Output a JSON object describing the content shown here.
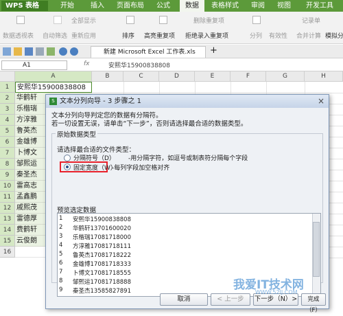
{
  "menubar": {
    "app_label": "WPS 表格",
    "items": [
      "开始",
      "插入",
      "页面布局",
      "公式",
      "数据",
      "表格样式",
      "审阅",
      "视图",
      "开发工具"
    ],
    "active_index": 4
  },
  "ribbon": {
    "buttons": [
      "数据透视表",
      "自动筛选",
      "全部显示",
      "重新应用",
      "排序",
      "高亮重复项",
      "删除重复项",
      "拒绝录入重复项",
      "分列",
      "有效性",
      "记录单",
      "合并计算",
      "模拟分"
    ]
  },
  "toolbar": {
    "document_tab": "新建 Microsoft Excel 工作表.xls",
    "new_tab": "+"
  },
  "formula": {
    "cell_ref": "A1",
    "fx_label": "fx",
    "content": "安熙华15900838808"
  },
  "sheet": {
    "columns": [
      "A",
      "B",
      "C",
      "D",
      "E",
      "F",
      "G",
      "H"
    ],
    "rows": [
      "1",
      "2",
      "3",
      "4",
      "5",
      "6",
      "7",
      "8",
      "9",
      "10",
      "11",
      "12",
      "13",
      "14",
      "15",
      "16"
    ],
    "cells": [
      "安熙华15900838808",
      "华鹤轩",
      "乐楷瑞",
      "方淳雅",
      "鲁英杰",
      "金雄博",
      "卜博文",
      "邹熙运",
      "秦圣杰",
      "雷高志",
      "孟鑫鹏",
      "戚熙茂",
      "雷德厚",
      "费鹤轩",
      "云俊朗",
      ""
    ]
  },
  "dialog": {
    "title": "文本分列向导 - 3 步骤之 1",
    "close": "×",
    "intro1": "文本分列向导判定您的数据有分隔符。",
    "intro2": "若一切设置无误，请单击“下一步”，否则请选择最合适的数据类型。",
    "group_title": "原始数据类型",
    "choose_label": "请选择最合适的文件类型：",
    "radio1_label": "分隔符号（D）",
    "radio1_desc": "-用分隔字符，如逗号或制表符分隔每个字段",
    "radio2_label": "固定宽度（W）",
    "radio2_desc": "-每列字段加空格对齐",
    "selected_option": "固定宽度（W）",
    "preview_label": "预览选定数据",
    "preview_rows": [
      {
        "n": "1",
        "t": "安熙华15900838808"
      },
      {
        "n": "2",
        "t": "华鹤轩13701600020"
      },
      {
        "n": "3",
        "t": "乐楷瑞17081718000"
      },
      {
        "n": "4",
        "t": "方淳雅17081718111"
      },
      {
        "n": "5",
        "t": "鲁英杰17081718222"
      },
      {
        "n": "6",
        "t": "金雄博17081718333"
      },
      {
        "n": "7",
        "t": "卜博文17081718555"
      },
      {
        "n": "8",
        "t": "邹熙运17081718888"
      },
      {
        "n": "9",
        "t": "秦圣杰13585827891"
      }
    ],
    "cancel": "取消",
    "prev": "< 上一步",
    "next": "下一步（N）>",
    "finish": "完成（F）"
  },
  "watermark": {
    "text": "我爱IT技术网",
    "sub": "WWW.52IJ.COM"
  },
  "colors": {
    "menubar": "#5c9a3a",
    "highlight": "#e8202a",
    "selection": "#eaf2e2"
  }
}
